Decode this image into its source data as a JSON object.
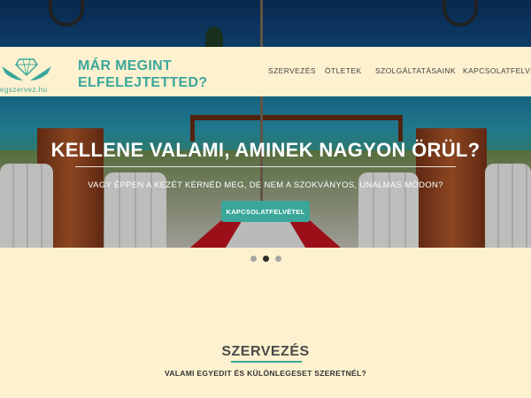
{
  "header": {
    "logo_text": "egszervez.hu",
    "brand_line1": "MÁR MEGINT",
    "brand_line2": "ELFELEJTETTED?",
    "nav": [
      {
        "label": "SZERVEZÉS"
      },
      {
        "label": "ÖTLETEK"
      },
      {
        "label": "SZOLGÁLTATÁSAINK"
      },
      {
        "label": "KAPCSOLATFELVÉTEL"
      }
    ]
  },
  "hero": {
    "title": "KELLENE VALAMI, AMINEK NAGYON ÖRÜL?",
    "subtitle": "VAGY ÉPPEN A KEZÉT KÉRNÉD MEG, DE NEM A SZOKVÁNYOS, UNALMAS MÓDON?",
    "cta_label": "KAPCSOLATFELVÉTEL",
    "carousel_active_index": 1,
    "carousel_count": 3
  },
  "section": {
    "title": "SZERVEZÉS",
    "subtitle": "VALAMI EGYEDIT ÉS KÜLÖNLEGESET SZERETNÉL?"
  },
  "colors": {
    "accent": "#3ba79a",
    "background": "#fdf1cf"
  }
}
